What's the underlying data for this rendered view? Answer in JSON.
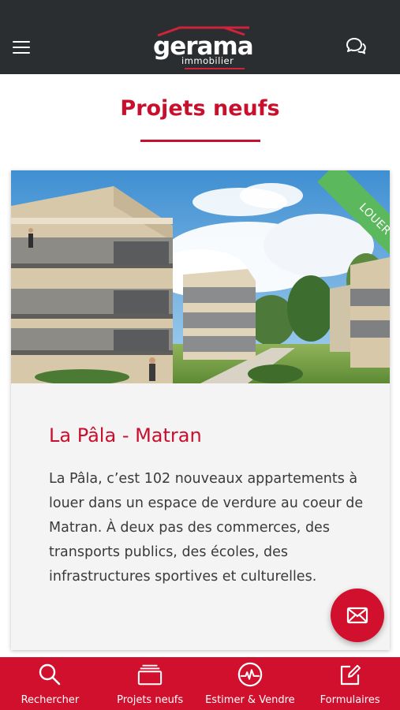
{
  "header": {
    "logo_main": "gerama",
    "logo_sub": "immobilier",
    "brand_color": "#c8102e",
    "bar_color": "#2b2e31"
  },
  "page": {
    "title": "Projets neufs"
  },
  "project": {
    "ribbon": "LOUER",
    "ribbon_color": "#5cb85c",
    "name": "La Pâla - Matran",
    "description": "La Pâla, c’est 102 nouveaux appartements à louer dans un espace de verdure au coeur de Matran. À deux pas des commerces, des transports publics, des écoles, des infrastructures sportives et culturelles."
  },
  "bottom_nav": {
    "items": [
      {
        "label": "Rechercher",
        "icon": "search-icon"
      },
      {
        "label": "Projets neufs",
        "icon": "projects-icon"
      },
      {
        "label": "Estimer & Vendre",
        "icon": "estimate-icon"
      },
      {
        "label": "Formulaires",
        "icon": "form-edit-icon"
      }
    ]
  }
}
